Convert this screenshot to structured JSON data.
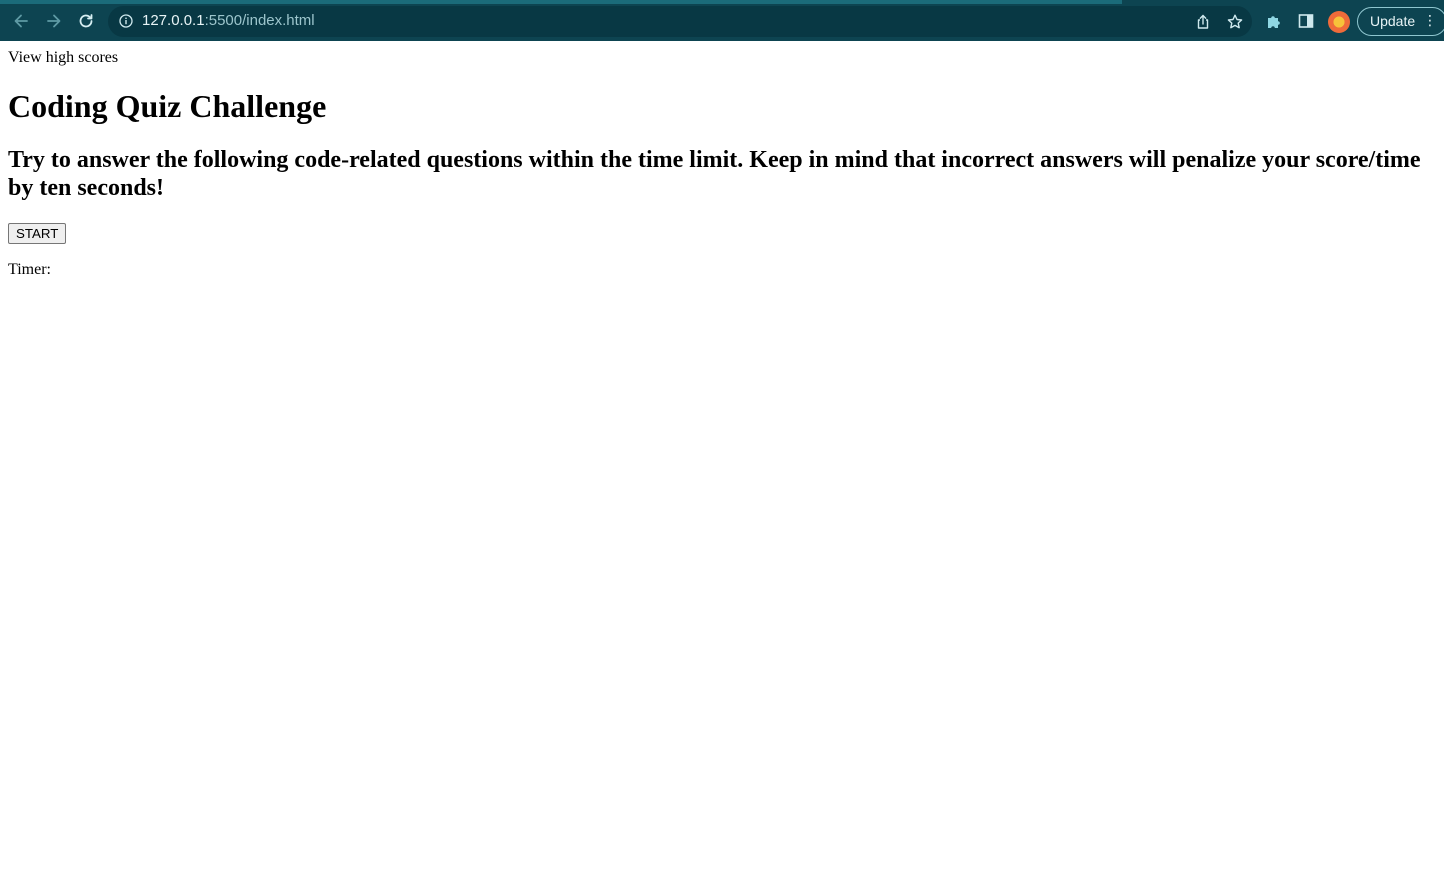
{
  "browser": {
    "url_host": "127.0.0.1",
    "url_rest": ":5500/index.html",
    "update_label": "Update",
    "icons": {
      "back": "arrow-left-icon",
      "forward": "arrow-right-icon",
      "reload": "reload-icon",
      "site_info": "info-icon",
      "share": "share-icon",
      "bookmark": "star-icon",
      "extensions": "puzzle-icon",
      "side_panel": "side-panel-icon",
      "menu": "kebab-menu-icon"
    },
    "colors": {
      "toolbar": "#0d4451",
      "omnibox": "#083844",
      "accent": "#8fc6cf"
    }
  },
  "page": {
    "high_scores_link": "View high scores",
    "title": "Coding Quiz Challenge",
    "instructions": "Try to answer the following code-related questions within the time limit. Keep in mind that incorrect answers will penalize your score/time by ten seconds!",
    "start_button": "START",
    "timer_label": "Timer:"
  }
}
